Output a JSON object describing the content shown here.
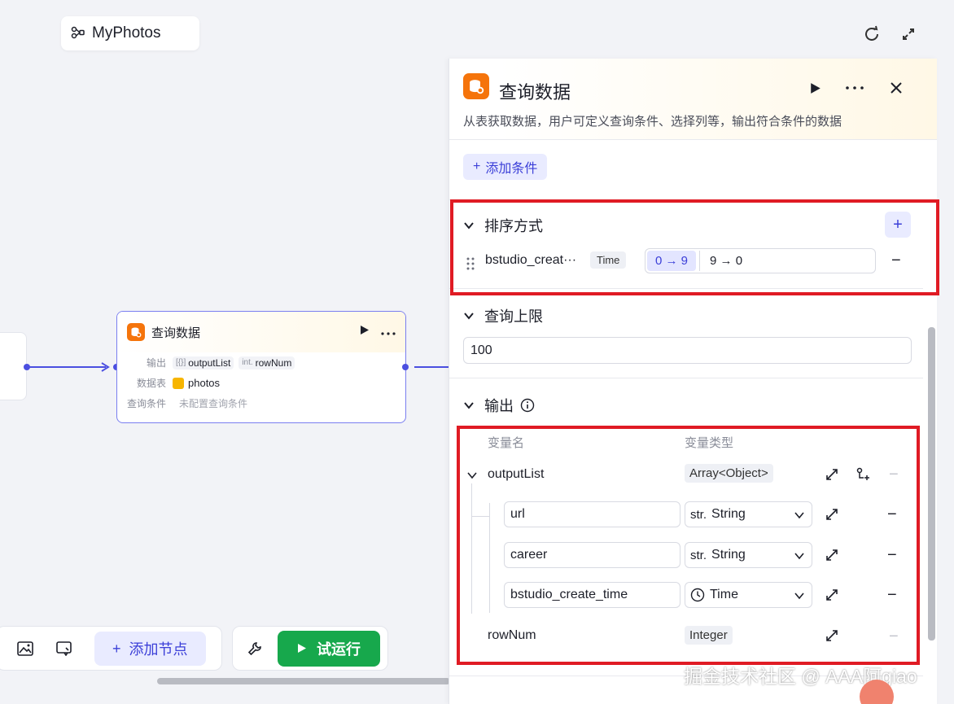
{
  "app": {
    "title": "MyPhotos"
  },
  "node": {
    "title": "查询数据",
    "output_label": "输出",
    "outputs": [
      {
        "type": "[{}]",
        "name": "outputList"
      },
      {
        "type": "int.",
        "name": "rowNum"
      }
    ],
    "table_label": "数据表",
    "table_value": "photos",
    "cond_label": "查询条件",
    "cond_value": "未配置查询条件"
  },
  "toolbar": {
    "add_node": "添加节点",
    "run": "试运行"
  },
  "panel": {
    "title": "查询数据",
    "description": "从表获取数据，用户可定义查询条件、选择列等，输出符合条件的数据",
    "add_condition": "添加条件",
    "sort": {
      "title": "排序方式",
      "field": "bstudio_creat···",
      "type": "Time",
      "asc": "0 → 9",
      "desc": "9 → 0"
    },
    "limit": {
      "title": "查询上限",
      "value": "100"
    },
    "output": {
      "title": "输出",
      "col_name": "变量名",
      "col_type": "变量类型",
      "root": {
        "name": "outputList",
        "type": "Array<Object>"
      },
      "children": [
        {
          "name": "url",
          "type_prefix": "str.",
          "type": "String"
        },
        {
          "name": "career",
          "type_prefix": "str.",
          "type": "String"
        },
        {
          "name": "bstudio_create_time",
          "type": "Time"
        }
      ],
      "row_num": {
        "name": "rowNum",
        "type": "Integer"
      }
    }
  },
  "watermark": "掘金技术社区 @ AAA阿giao",
  "colors": {
    "accent": "#3b3fd8",
    "brand_icon": "#f5740b",
    "run": "#17a84c",
    "highlight": "#e01b24"
  }
}
